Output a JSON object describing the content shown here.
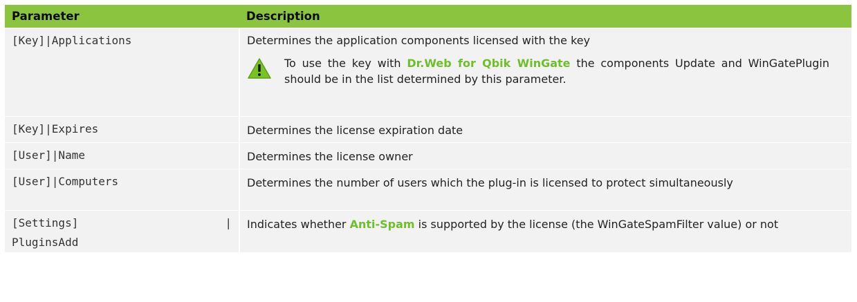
{
  "table": {
    "headers": {
      "parameter": "Parameter",
      "description": "Description"
    },
    "rows": [
      {
        "param": "[Key]|Applications",
        "desc": "Determines the application components licensed with the key",
        "note": {
          "icon": "warning-icon",
          "before": "To use the key with ",
          "highlight": "Dr.Web for Qbik WinGate",
          "after": " the components Update and WinGatePlugin should be in the list determined by this parameter."
        }
      },
      {
        "param": "[Key]|Expires",
        "desc": "Determines the license expiration date"
      },
      {
        "param": "[User]|Name",
        "desc": "Determines the license owner"
      },
      {
        "param": "[User]|Computers",
        "desc": "Determines the number of users which the plug-in is licensed to protect simultaneously"
      },
      {
        "param_left": "[Settings]",
        "param_right": "|",
        "param_line2": "PluginsAdd",
        "desc_before": "Indicates whether ",
        "desc_highlight": "Anti-Spam",
        "desc_after": " is supported by the license (the WinGateSpamFilter value) or not"
      }
    ]
  },
  "colors": {
    "header_bg": "#8bc53f",
    "row_bg": "#f2f2f2",
    "highlight": "#6fbf2b",
    "warning": "#79c225"
  }
}
